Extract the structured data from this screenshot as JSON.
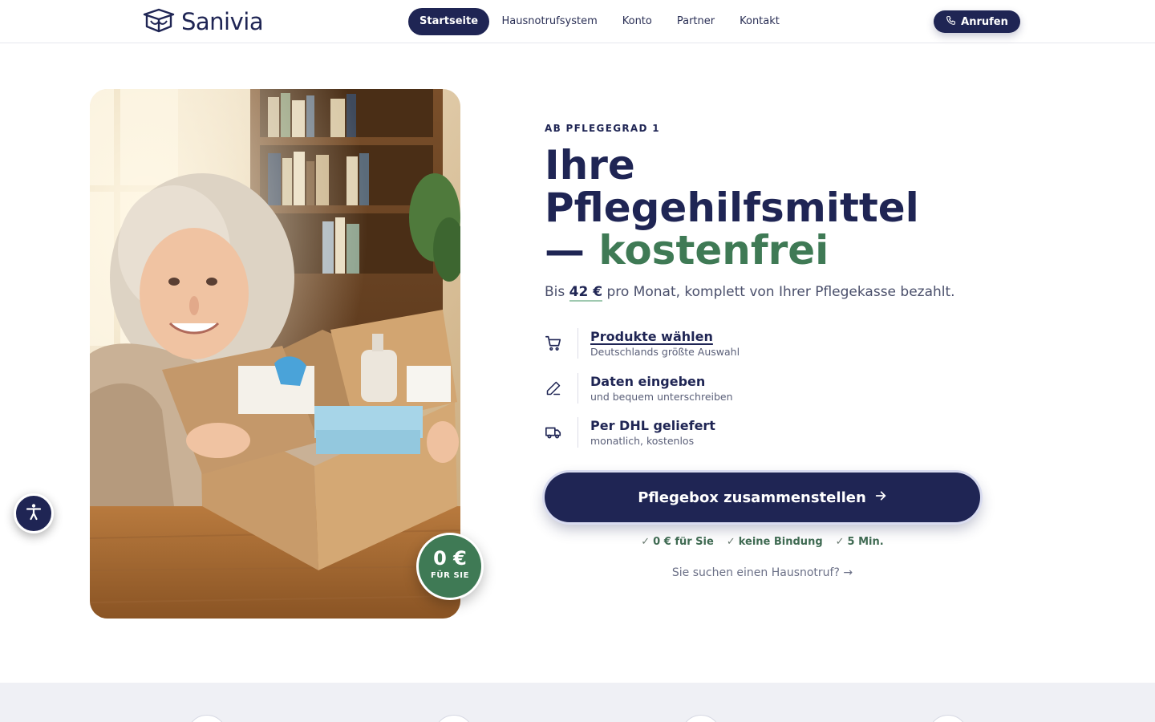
{
  "header": {
    "logo_text": "Sanivia",
    "logo_icon": "box-logo-icon",
    "nav": [
      {
        "label": "Startseite",
        "active": true
      },
      {
        "label": "Hausnotrufsystem",
        "active": false
      },
      {
        "label": "Konto",
        "active": false
      },
      {
        "label": "Partner",
        "active": false
      },
      {
        "label": "Kontakt",
        "active": false
      }
    ],
    "call_button": {
      "label": "Anrufen",
      "icon": "phone-icon"
    }
  },
  "hero": {
    "badge": {
      "amount": "0 €",
      "label": "FÜR SIE"
    },
    "eyebrow": "AB PFLEGEGRAD 1",
    "headline_line1": "Ihre",
    "headline_line2": "Pflegehilfsmittel",
    "headline_dash": "— ",
    "headline_accent": "kostenfrei",
    "sub_prefix": "Bis ",
    "sub_amount": "42 €",
    "sub_suffix": " pro Monat, komplett von Ihrer Pflegekasse bezahlt.",
    "steps": [
      {
        "title": "Produkte wählen",
        "subtitle": "Deutschlands größte Auswahl",
        "icon": "cart-icon"
      },
      {
        "title": "Daten eingeben",
        "subtitle": "und bequem unterschreiben",
        "icon": "pen-icon"
      },
      {
        "title": "Per DHL geliefert",
        "subtitle": "monatlich, kostenlos",
        "icon": "truck-icon"
      }
    ],
    "cta_label": "Pflegebox zusammenstellen",
    "checks": [
      {
        "mark": "✓",
        "text": "0 € für Sie"
      },
      {
        "mark": "✓",
        "text": "keine Bindung"
      },
      {
        "mark": "✓",
        "text": "5 Min."
      }
    ],
    "hausnotruf_link": "Sie suchen einen Hausnotruf? →"
  },
  "colors": {
    "primary": "#1f2554",
    "accent_green": "#3f7a55",
    "section_bg": "#eff0f5"
  }
}
